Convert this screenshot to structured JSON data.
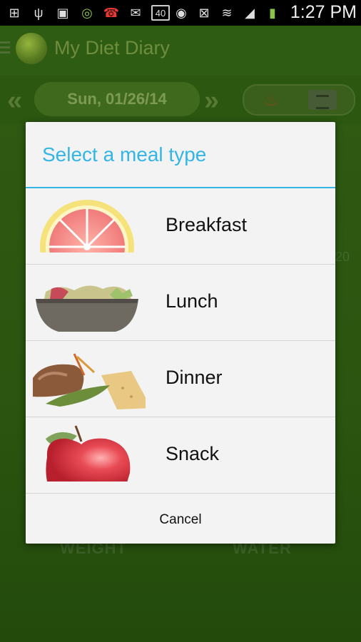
{
  "status_bar": {
    "time": "1:27 PM",
    "notification_badge": "40",
    "icons_left": [
      "add-icon",
      "usb-icon",
      "image-icon",
      "wifi-shield-icon",
      "missed-call-icon",
      "gmail-icon",
      "notification-count-icon"
    ],
    "icons_right": [
      "eye-icon",
      "nfc-icon",
      "wifi-icon",
      "signal-icon",
      "battery-charging-icon"
    ]
  },
  "app": {
    "title": "My Diet Diary",
    "date": "Sun, 01/26/14",
    "bg_weight": "WEIGHT",
    "bg_water": "WATER",
    "bg_partial_number": "20"
  },
  "dialog": {
    "title": "Select a meal type",
    "accent_color": "#33b5e5",
    "options": [
      {
        "label": "Breakfast",
        "icon": "grapefruit-icon"
      },
      {
        "label": "Lunch",
        "icon": "salad-bowl-icon"
      },
      {
        "label": "Dinner",
        "icon": "dinner-plate-icon"
      },
      {
        "label": "Snack",
        "icon": "apple-icon"
      }
    ],
    "cancel_label": "Cancel"
  }
}
